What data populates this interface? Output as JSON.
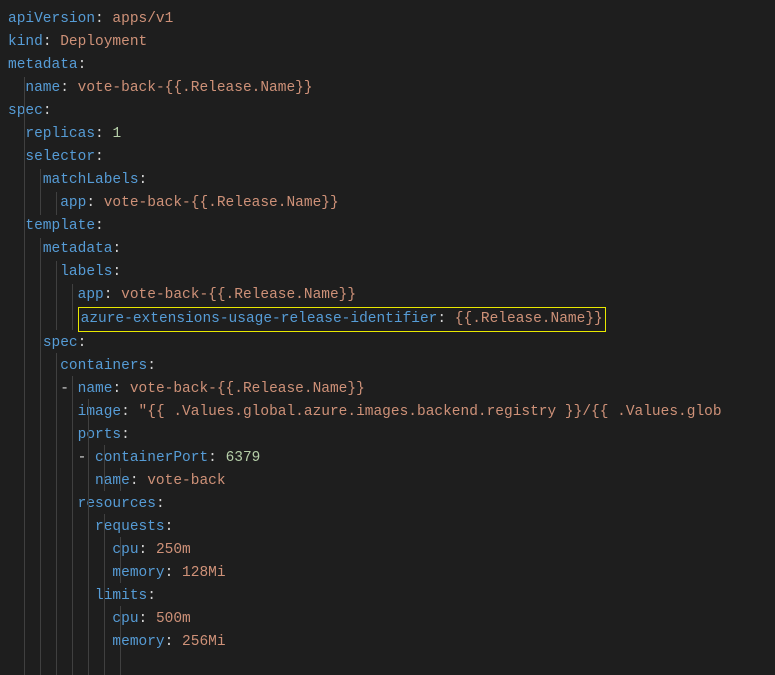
{
  "code": {
    "l1_key": "apiVersion",
    "l1_val": "apps/v1",
    "l2_key": "kind",
    "l2_val": "Deployment",
    "l3_key": "metadata",
    "l4_key": "name",
    "l4_val": "vote-back-{{.Release.Name}}",
    "l5_key": "spec",
    "l6_key": "replicas",
    "l6_val": "1",
    "l7_key": "selector",
    "l8_key": "matchLabels",
    "l9_key": "app",
    "l9_val": "vote-back-{{.Release.Name}}",
    "l10_key": "template",
    "l11_key": "metadata",
    "l12_key": "labels",
    "l13_key": "app",
    "l13_val": "vote-back-{{.Release.Name}}",
    "l14_key": "azure-extensions-usage-release-identifier",
    "l14_val": "{{.Release.Name}}",
    "l15_key": "spec",
    "l16_key": "containers",
    "l17_key": "name",
    "l17_val": "vote-back-{{.Release.Name}}",
    "l18_key": "image",
    "l18_val": "\"{{ .Values.global.azure.images.backend.registry }}/{{ .Values.glob",
    "l19_key": "ports",
    "l20_key": "containerPort",
    "l20_val": "6379",
    "l21_key": "name",
    "l21_val": "vote-back",
    "l22_key": "resources",
    "l23_key": "requests",
    "l24_key": "cpu",
    "l24_val": "250m",
    "l25_key": "memory",
    "l25_val": "128Mi",
    "l26_key": "limits",
    "l27_key": "cpu",
    "l27_val": "500m",
    "l28_key": "memory",
    "l28_val": "256Mi"
  }
}
